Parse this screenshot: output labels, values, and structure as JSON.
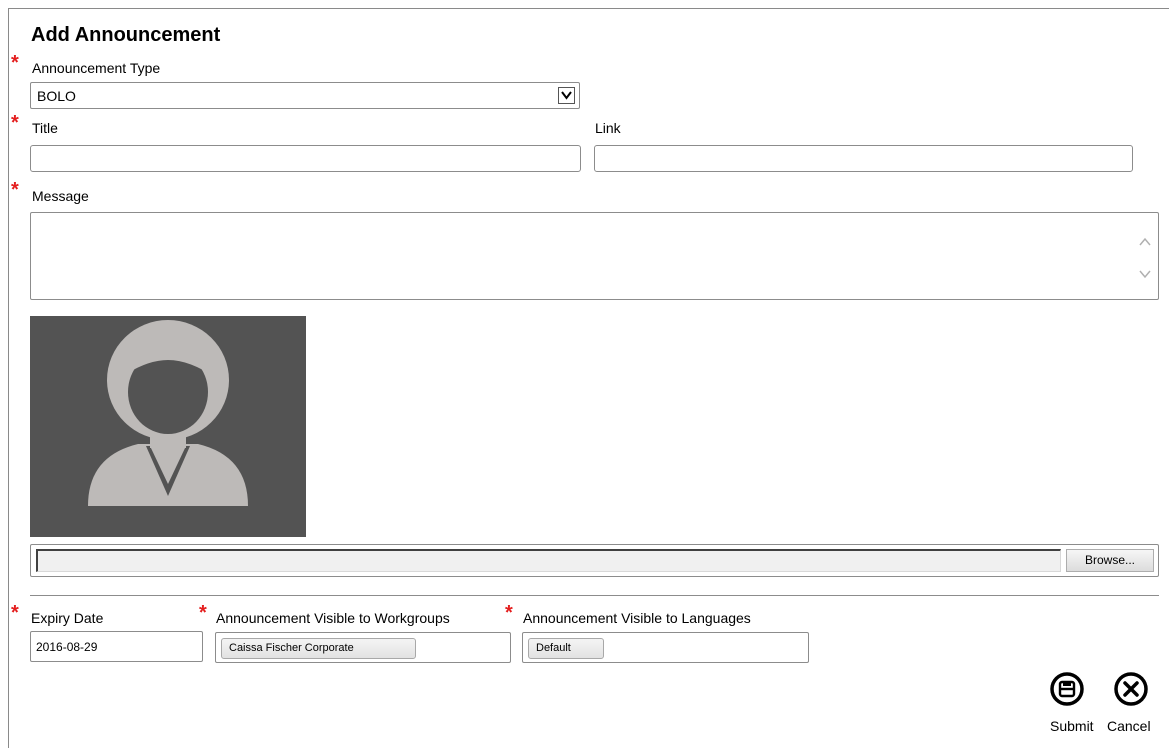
{
  "form": {
    "title": "Add Announcement",
    "required_marker": "*",
    "announcement_type": {
      "label": "Announcement Type",
      "value": "BOLO"
    },
    "title_field": {
      "label": "Title",
      "value": ""
    },
    "link_field": {
      "label": "Link",
      "value": ""
    },
    "message_field": {
      "label": "Message",
      "value": ""
    },
    "image": {
      "icon": "user-avatar-placeholder"
    },
    "file_upload": {
      "path": "",
      "browse_label": "Browse..."
    },
    "expiry_date": {
      "label": "Expiry Date",
      "value": "2016-08-29"
    },
    "workgroups": {
      "label": "Announcement Visible to Workgroups",
      "chips": [
        "Caissa Fischer Corporate"
      ]
    },
    "languages": {
      "label": "Announcement Visible to Languages",
      "chips": [
        "Default"
      ]
    }
  },
  "actions": {
    "submit_label": "Submit",
    "cancel_label": "Cancel"
  },
  "colors": {
    "required": "#e41e1e",
    "avatar_bg": "#535353",
    "avatar_fg": "#bdbab8"
  }
}
